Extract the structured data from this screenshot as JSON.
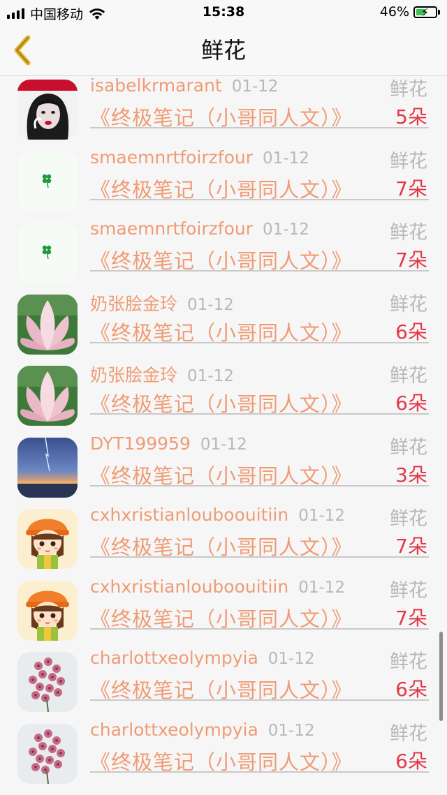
{
  "status_bar": {
    "carrier": "中国移动",
    "time": "15:38",
    "battery": "46%",
    "battery_level": 0.46
  },
  "nav": {
    "title": "鲜花",
    "back_icon": "chevron-left-icon"
  },
  "rows": [
    {
      "user": "isabelkrmarant",
      "date": "01-12",
      "book": "《终极笔记（小哥同人文）》",
      "tag": "鲜花",
      "count": "5朵",
      "avatar": "portrait-avatar"
    },
    {
      "user": "smaemnrtfoirzfour",
      "date": "01-12",
      "book": "《终极笔记（小哥同人文）》",
      "tag": "鲜花",
      "count": "7朵",
      "avatar": "clover-avatar"
    },
    {
      "user": "smaemnrtfoirzfour",
      "date": "01-12",
      "book": "《终极笔记（小哥同人文）》",
      "tag": "鲜花",
      "count": "7朵",
      "avatar": "clover-avatar"
    },
    {
      "user": "奶张脍金玲",
      "date": "01-12",
      "book": "《终极笔记（小哥同人文）》",
      "tag": "鲜花",
      "count": "6朵",
      "avatar": "lotus-avatar"
    },
    {
      "user": "奶张脍金玲",
      "date": "01-12",
      "book": "《终极笔记（小哥同人文）》",
      "tag": "鲜花",
      "count": "6朵",
      "avatar": "lotus-avatar"
    },
    {
      "user": "DYT199959",
      "date": "01-12",
      "book": "《终极笔记（小哥同人文）》",
      "tag": "鲜花",
      "count": "3朵",
      "avatar": "sky-avatar"
    },
    {
      "user": "cxhxristianlouboouitiin",
      "date": "01-12",
      "book": "《终极笔记（小哥同人文）》",
      "tag": "鲜花",
      "count": "7朵",
      "avatar": "cartoon-girl-avatar"
    },
    {
      "user": "cxhxristianlouboouitiin",
      "date": "01-12",
      "book": "《终极笔记（小哥同人文）》",
      "tag": "鲜花",
      "count": "7朵",
      "avatar": "cartoon-girl-avatar"
    },
    {
      "user": "charlottxeolympyia",
      "date": "01-12",
      "book": "《终极笔记（小哥同人文）》",
      "tag": "鲜花",
      "count": "6朵",
      "avatar": "pink-flowers-avatar"
    },
    {
      "user": "charlottxeolympyia",
      "date": "01-12",
      "book": "《终极笔记（小哥同人文）》",
      "tag": "鲜花",
      "count": "6朵",
      "avatar": "pink-flowers-avatar"
    }
  ]
}
